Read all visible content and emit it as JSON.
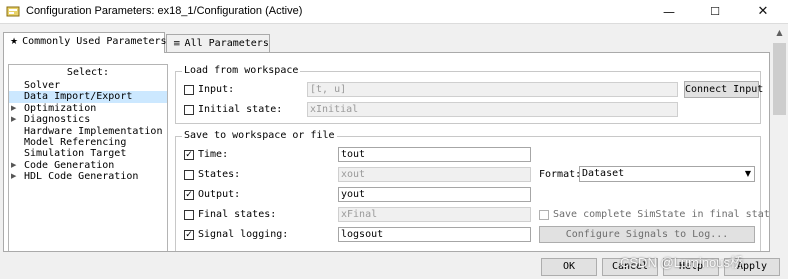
{
  "window": {
    "title": "Configuration Parameters: ex18_1/Configuration (Active)",
    "minimize_glyph": "—",
    "maximize_glyph": "☐",
    "close_glyph": "✕"
  },
  "tabs": [
    {
      "icon": "★",
      "label": "Commonly Used Parameters"
    },
    {
      "icon": "≡",
      "label": "All Parameters"
    }
  ],
  "select": {
    "title": "Select:",
    "items": [
      {
        "label": "Solver",
        "expandable": false,
        "selected": false
      },
      {
        "label": "Data Import/Export",
        "expandable": false,
        "selected": true
      },
      {
        "label": "Optimization",
        "expandable": true,
        "selected": false
      },
      {
        "label": "Diagnostics",
        "expandable": true,
        "selected": false
      },
      {
        "label": "Hardware Implementation",
        "expandable": false,
        "selected": false
      },
      {
        "label": "Model Referencing",
        "expandable": false,
        "selected": false
      },
      {
        "label": "Simulation Target",
        "expandable": false,
        "selected": false
      },
      {
        "label": "Code Generation",
        "expandable": true,
        "selected": false
      },
      {
        "label": "HDL Code Generation",
        "expandable": true,
        "selected": false
      }
    ],
    "expand_glyph": "▶"
  },
  "load": {
    "title": "Load from workspace",
    "input_label": "Input:",
    "input_value": "[t, u]",
    "connect_button": "Connect Input",
    "initial_state_label": "Initial state:",
    "initial_state_value": "xInitial"
  },
  "save": {
    "title": "Save to workspace or file",
    "time_label": "Time:",
    "time_value": "tout",
    "time_checked": true,
    "states_label": "States:",
    "states_value": "xout",
    "states_checked": false,
    "format_label": "Format:",
    "format_value": "Dataset",
    "output_label": "Output:",
    "output_value": "yout",
    "output_checked": true,
    "final_states_label": "Final states:",
    "final_states_value": "xFinal",
    "final_states_checked": false,
    "complete_simstate_label": "Save complete SimState in final state",
    "signal_logging_label": "Signal logging:",
    "signal_logging_value": "logsout",
    "signal_logging_checked": true,
    "configure_button": "Configure Signals to Log..."
  },
  "footer": {
    "ok": "OK",
    "cancel": "Cancel",
    "help": "Help",
    "apply": "Apply"
  },
  "watermark": "CSDN @Luminous桥",
  "check_glyph": "✓",
  "colors": {
    "selection": "#cce8ff",
    "panel": "#ffffff",
    "chrome": "#f0f0f0"
  }
}
